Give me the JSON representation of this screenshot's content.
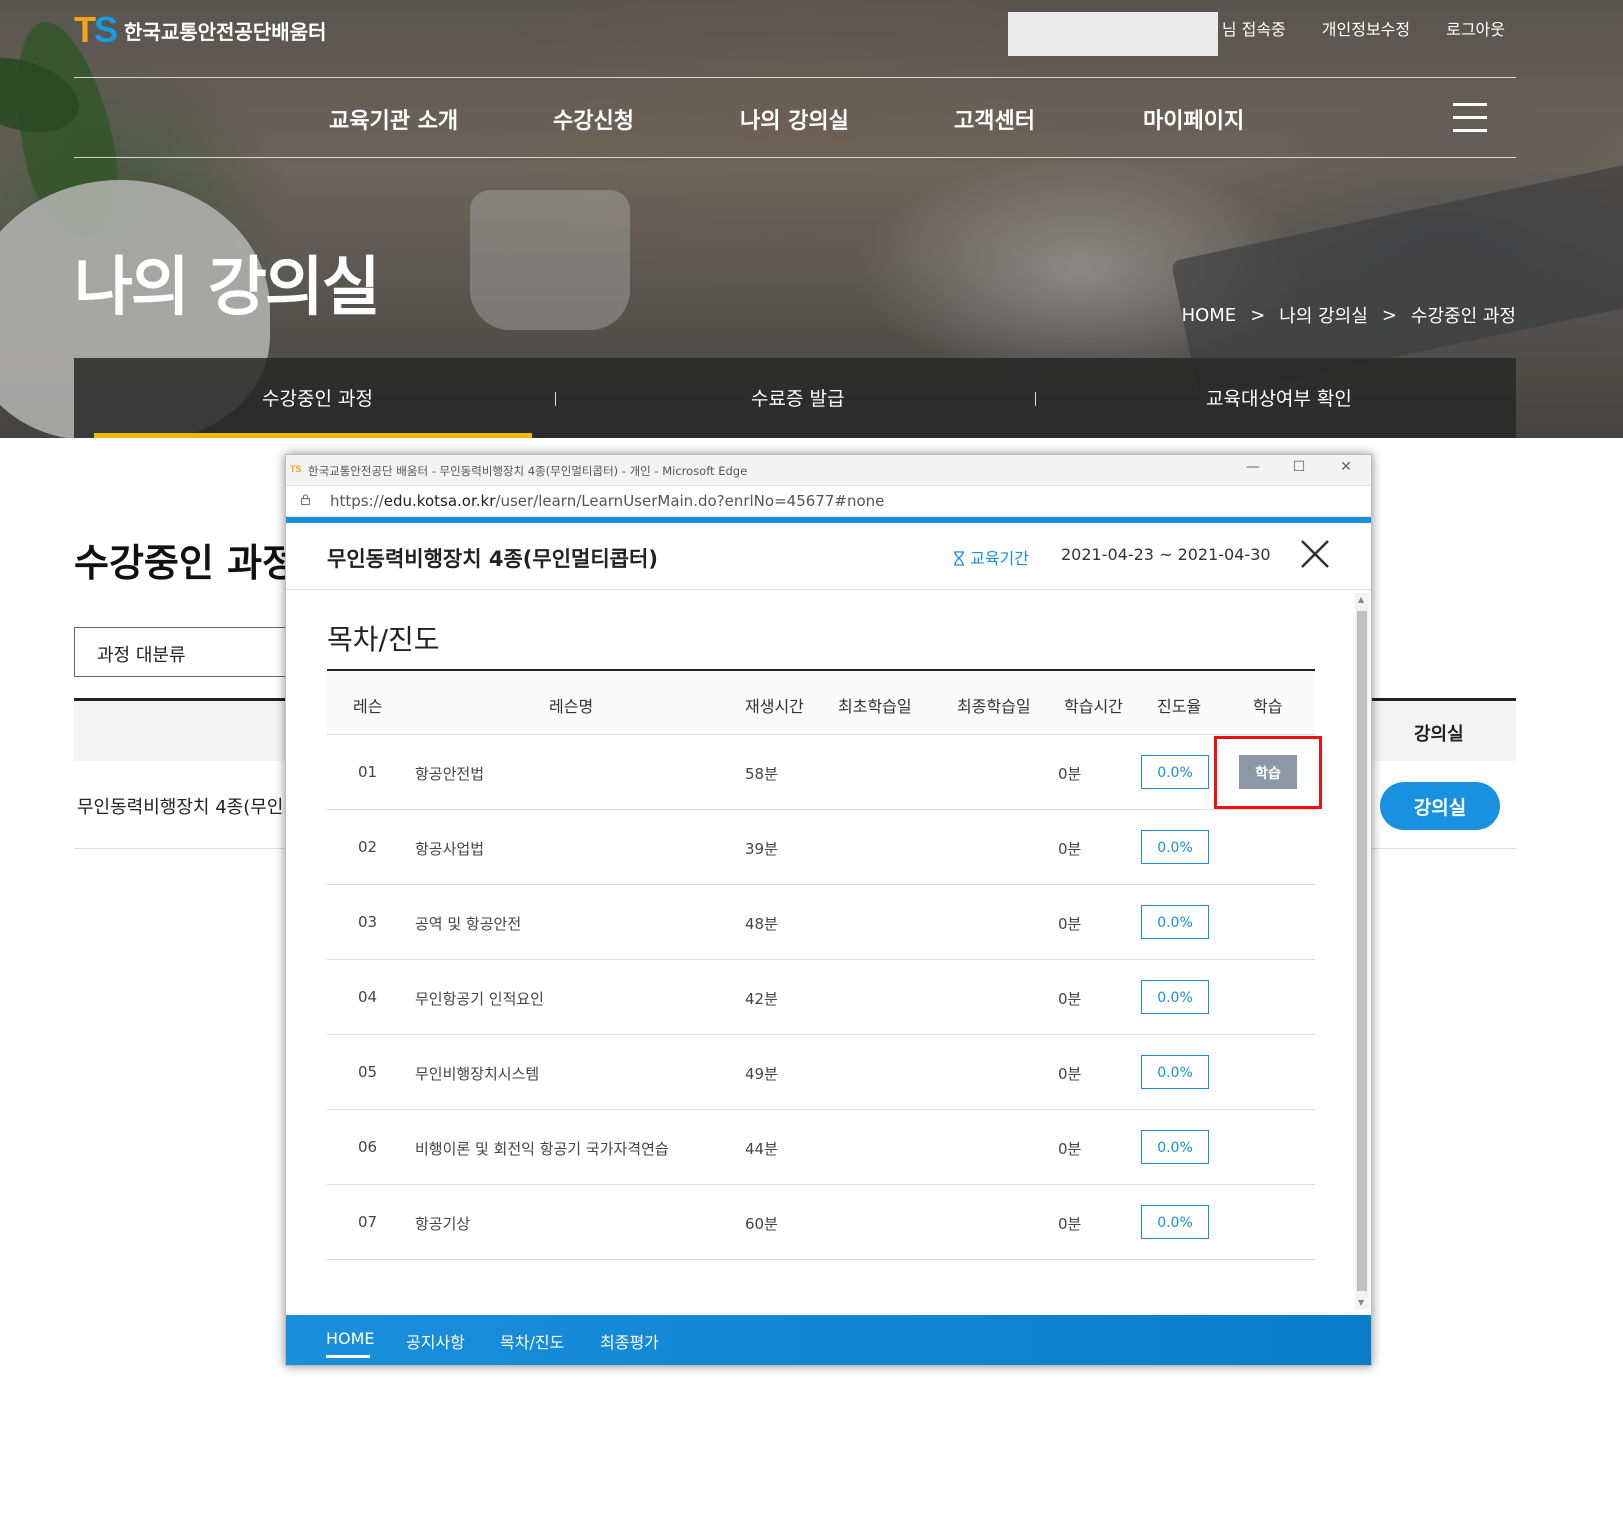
{
  "header": {
    "logo_mark": "TS",
    "logo_name": "한국교통안전공단배움터",
    "user_status": "님 접속중",
    "links": [
      "개인정보수정",
      "로그아웃"
    ],
    "gnb": [
      "교육기관 소개",
      "수강신청",
      "나의 강의실",
      "고객센터",
      "마이페이지"
    ],
    "page_title": "나의 강의실",
    "breadcrumb": [
      "HOME",
      "나의 강의실",
      "수강중인 과정"
    ],
    "breadcrumb_sep": ">",
    "subnav": [
      "수강중인 과정",
      "수료증 발급",
      "교육대상여부 확인"
    ],
    "subnav_active": "수강중인 과정"
  },
  "main": {
    "section_title": "수강중인 과정",
    "category_select": "과정 대분류",
    "table_last_header": "강의실",
    "row_course": "무인동력비행장치 4종(무인",
    "room_button": "강의실"
  },
  "popup": {
    "window_title": "한국교통안전공단 배움터 - 무인동력비행장치 4종(무인멀티콥터) - 개인 - Microsoft Edge",
    "url_prefix": "https://",
    "url_domain": "edu.kotsa.or.kr",
    "url_path": "/user/learn/LearnUserMain.do?enrlNo=45677#none",
    "course_name": "무인동력비행장치 4종(무인멀티콥터)",
    "period_label": "교육기간",
    "period": "2021-04-23 ~ 2021-04-30",
    "toc_title": "목차/진도",
    "columns": [
      "레슨",
      "레슨명",
      "재생시간",
      "최초학습일",
      "최종학습일",
      "학습시간",
      "진도율",
      "학습"
    ],
    "lessons": [
      {
        "no": "01",
        "name": "항공안전법",
        "duration": "58분",
        "first": "",
        "last": "",
        "study_time": "0분",
        "progress": "0.0%",
        "action": "학습"
      },
      {
        "no": "02",
        "name": "항공사업법",
        "duration": "39분",
        "first": "",
        "last": "",
        "study_time": "0분",
        "progress": "0.0%",
        "action": ""
      },
      {
        "no": "03",
        "name": "공역 및 항공안전",
        "duration": "48분",
        "first": "",
        "last": "",
        "study_time": "0분",
        "progress": "0.0%",
        "action": ""
      },
      {
        "no": "04",
        "name": "무인항공기 인적요인",
        "duration": "42분",
        "first": "",
        "last": "",
        "study_time": "0분",
        "progress": "0.0%",
        "action": ""
      },
      {
        "no": "05",
        "name": "무인비행장치시스템",
        "duration": "49분",
        "first": "",
        "last": "",
        "study_time": "0분",
        "progress": "0.0%",
        "action": ""
      },
      {
        "no": "06",
        "name": "비행이론 및 회전익 항공기 국가자격연습",
        "duration": "44분",
        "first": "",
        "last": "",
        "study_time": "0분",
        "progress": "0.0%",
        "action": ""
      },
      {
        "no": "07",
        "name": "항공기상",
        "duration": "60분",
        "first": "",
        "last": "",
        "study_time": "0분",
        "progress": "0.0%",
        "action": ""
      }
    ],
    "bottom_nav": [
      "HOME",
      "공지사항",
      "목차/진도",
      "최종평가"
    ],
    "bottom_nav_active": "HOME"
  },
  "colors": {
    "accent_blue": "#1a8fdb",
    "active_tab_bar": "#f2b705",
    "highlight_box": "#ee1111",
    "logo_t": "#f7a21b",
    "logo_s": "#1a9be0"
  }
}
